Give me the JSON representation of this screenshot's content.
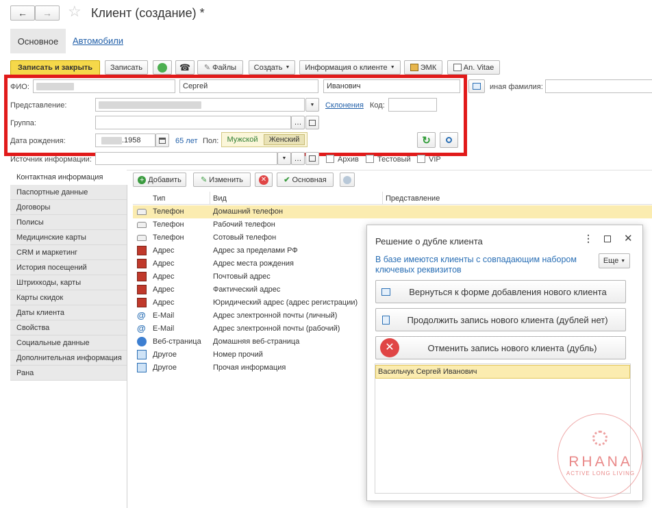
{
  "window": {
    "title": "Клиент (создание) *"
  },
  "nav": {
    "back_glyph": "←",
    "forward_glyph": "→",
    "star_glyph": "☆"
  },
  "tabs": {
    "main": "Основное",
    "cars": "Автомобили"
  },
  "toolbar": {
    "save_close": "Записать и закрыть",
    "save": "Записать",
    "files": "Файлы",
    "create": "Создать",
    "client_info": "Информация о клиенте",
    "emk": "ЭМК",
    "vitae": "An. Vitae"
  },
  "form": {
    "fio_label": "ФИО:",
    "first_name": "Сергей",
    "patronymic": "Иванович",
    "other_surname_label": "иная фамилия:",
    "repr_label": "Представление:",
    "declension_link": "Склонения",
    "code_label": "Код:",
    "group_label": "Группа:",
    "birth_label": "Дата рождения:",
    "birth_year": ".1958",
    "age": "65 лет",
    "sex_label": "Пол:",
    "male": "Мужской",
    "female": "Женский",
    "source_label": "Источник информации:",
    "archive": "Архив",
    "test": "Тестовый",
    "vip": "VIP"
  },
  "side_tabs": [
    "Контактная информация",
    "Паспортные данные",
    "Договоры",
    "Полисы",
    "Медицинские карты",
    "CRM и маркетинг",
    "История посещений",
    "Штрихкоды, карты",
    "Карты скидок",
    "Даты клиента",
    "Свойства",
    "Социальные данные",
    "Дополнительная информация",
    "Рана"
  ],
  "contacts_toolbar": {
    "add": "Добавить",
    "edit": "Изменить",
    "primary": "Основная"
  },
  "table": {
    "headers": {
      "type": "Тип",
      "kind": "Вид",
      "repr": "Представление"
    },
    "rows": [
      {
        "icon": "phone-icon",
        "type": "Телефон",
        "kind": "Домашний телефон"
      },
      {
        "icon": "phone-icon",
        "type": "Телефон",
        "kind": "Рабочий телефон"
      },
      {
        "icon": "phone-icon",
        "type": "Телефон",
        "kind": "Сотовый телефон"
      },
      {
        "icon": "address-icon",
        "type": "Адрес",
        "kind": "Адрес за пределами РФ"
      },
      {
        "icon": "address-icon",
        "type": "Адрес",
        "kind": "Адрес места рождения"
      },
      {
        "icon": "address-icon",
        "type": "Адрес",
        "kind": "Почтовый адрес"
      },
      {
        "icon": "address-icon",
        "type": "Адрес",
        "kind": "Фактический адрес"
      },
      {
        "icon": "address-icon",
        "type": "Адрес",
        "kind": "Юридический адрес (адрес регистрации)"
      },
      {
        "icon": "email-icon",
        "type": "E-Mail",
        "kind": "Адрес электронной почты (личный)"
      },
      {
        "icon": "email-icon",
        "type": "E-Mail",
        "kind": "Адрес электронной почты (рабочий)"
      },
      {
        "icon": "web-icon",
        "type": "Веб-страница",
        "kind": "Домашняя веб-страница"
      },
      {
        "icon": "other-icon",
        "type": "Другое",
        "kind": "Номер прочий"
      },
      {
        "icon": "other-icon",
        "type": "Другое",
        "kind": "Прочая информация"
      }
    ]
  },
  "dialog": {
    "title": "Решение о дубле клиента",
    "message": "В базе имеются клиенты с совпадающим набором ключевых реквизитов",
    "more": "Еще",
    "btn_return": "Вернуться к форме добавления нового клиента",
    "btn_continue": "Продолжить запись нового клиента (дублей нет)",
    "btn_cancel": "Отменить запись нового клиента (дубль)",
    "duplicates": [
      "Васильчук Сергей Иванович"
    ]
  },
  "watermark": {
    "brand": "RHANA",
    "tagline": "ACTIVE LONG LIVING"
  },
  "colors": {
    "accent_yellow": "#f5d84a",
    "highlight_red": "#e11a1a",
    "link_blue": "#1f5ea8",
    "selection": "#fbecb0"
  }
}
